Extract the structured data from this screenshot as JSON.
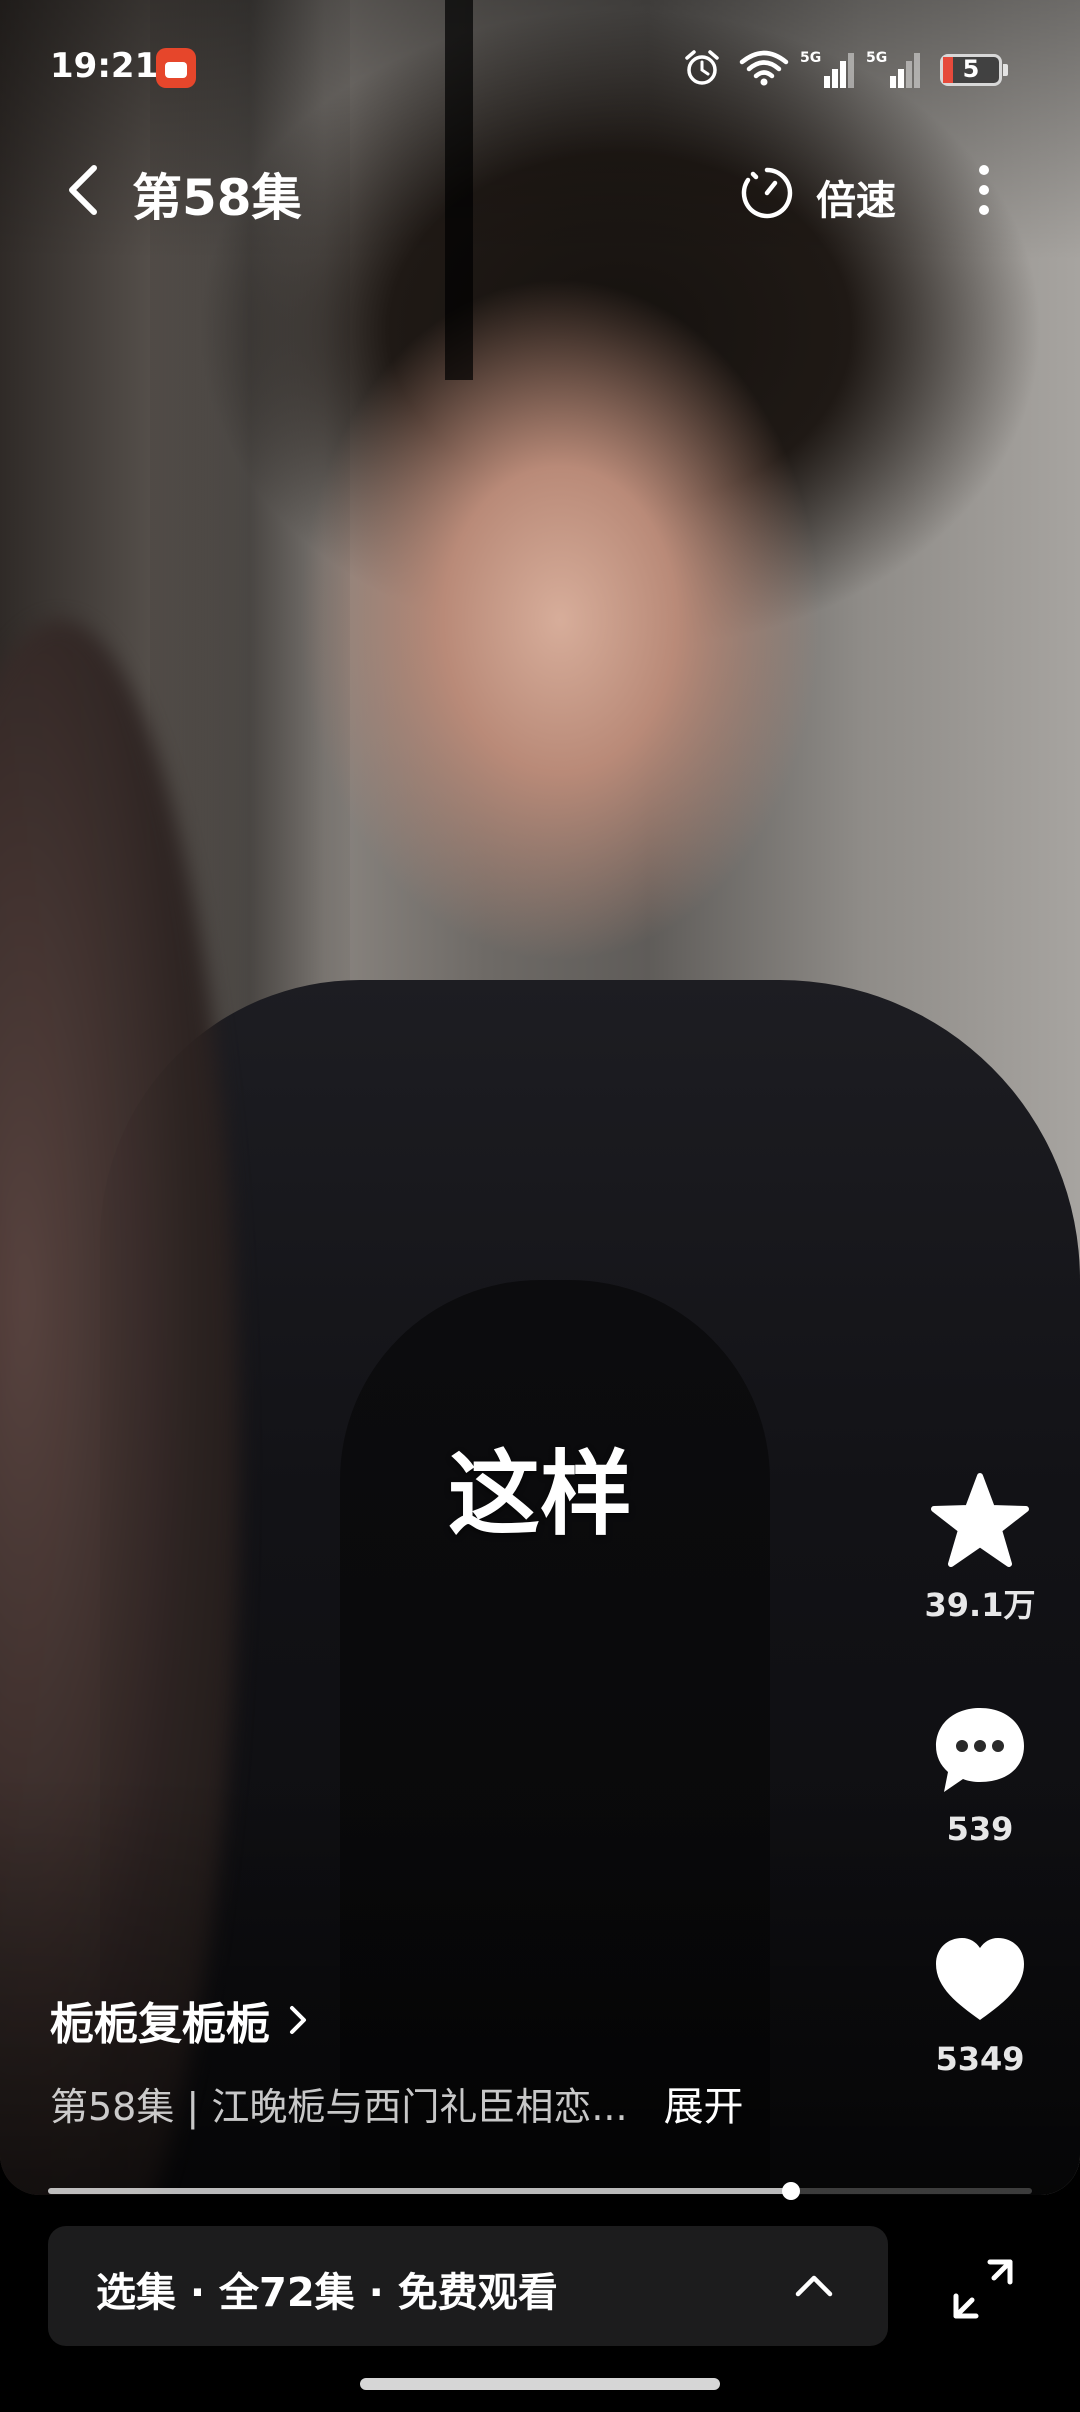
{
  "status_bar": {
    "time": "19:21",
    "app_icon": "red-app-notification-icon",
    "icons": [
      "alarm-icon",
      "wifi-icon",
      "signal-5g-icon",
      "signal-5g-icon"
    ],
    "signal_labels": [
      "5G",
      "5G"
    ],
    "battery_level": "5",
    "battery_color": "#e64a3b"
  },
  "nav": {
    "back_icon": "chevron-left-icon",
    "title": "第58集",
    "speed_icon": "speed-dial-icon",
    "speed_label": "倍速",
    "more_icon": "more-vertical-icon"
  },
  "video": {
    "subtitle": "这样",
    "progress": 0.755
  },
  "actions": {
    "collect": {
      "icon": "star-icon",
      "count": "39.1万"
    },
    "comment": {
      "icon": "comment-bubble-icon",
      "count": "539"
    },
    "like": {
      "icon": "heart-icon",
      "count": "5349"
    }
  },
  "info": {
    "drama_name": "栀栀复栀栀",
    "drama_chevron_icon": "chevron-right-icon",
    "description": "第58集 | 江晚栀与西门礼臣相恋...",
    "expand_label": "展开"
  },
  "bottom_bar": {
    "episode_selector_label": "选集 · 全72集 · 免费观看",
    "episode_selector_icon": "chevron-up-icon",
    "fullscreen_icon": "fullscreen-icon"
  }
}
